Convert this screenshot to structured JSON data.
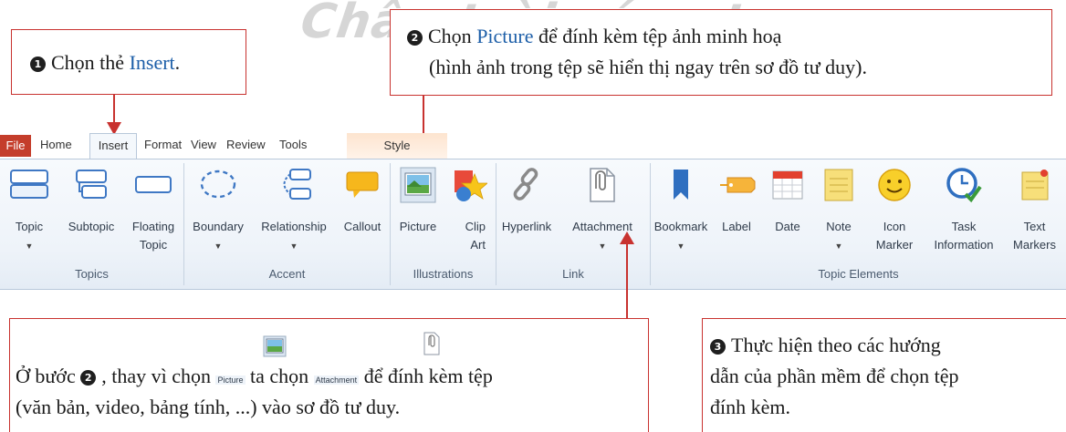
{
  "watermark": "Chân trời sáng tạo",
  "callout1": {
    "number": "1",
    "prefix": "Chọn thẻ ",
    "highlight": "Insert",
    "suffix": "."
  },
  "callout2": {
    "number": "2",
    "prefix": "Chọn ",
    "highlight": "Picture",
    "line1_suffix": " để đính kèm tệp ảnh minh hoạ",
    "line2": "(hình ảnh trong tệp sẽ hiển thị ngay trên sơ đồ tư duy)."
  },
  "callout3": {
    "number": "3",
    "line1": "Thực hiện theo các hướng",
    "line2": "dẫn của phần mềm để chọn tệp",
    "line3": "đính kèm."
  },
  "note": {
    "prefix": "Ở bước ",
    "number": "2",
    "mid1": ", thay vì chọn ",
    "picture_mini_label": "Picture",
    "mid2": " ta chọn ",
    "attachment_mini_label": "Attachment",
    "suffix": " để đính kèm tệp",
    "line2": "(văn bản, video, bảng tính, ...) vào sơ đồ tư duy."
  },
  "tabs": {
    "file": "File",
    "home": "Home",
    "insert": "Insert",
    "format": "Format",
    "view": "View",
    "review": "Review",
    "tools": "Tools",
    "style": "Style"
  },
  "ribbon": {
    "topic": "Topic",
    "subtopic": "Subtopic",
    "floating_l1": "Floating",
    "floating_l2": "Topic",
    "boundary": "Boundary",
    "relationship": "Relationship",
    "callout": "Callout",
    "picture": "Picture",
    "clip_l1": "Clip",
    "clip_l2": "Art",
    "hyperlink": "Hyperlink",
    "attachment": "Attachment",
    "bookmark": "Bookmark",
    "label": "Label",
    "date": "Date",
    "note": "Note",
    "icon_l1": "Icon",
    "icon_l2": "Marker",
    "task_l1": "Task",
    "task_l2": "Information",
    "text_l1": "Text",
    "text_l2": "Markers"
  },
  "groups": {
    "topics": "Topics",
    "accent": "Accent",
    "illustrations": "Illustrations",
    "link": "Link",
    "topic_elements": "Topic Elements"
  },
  "colors": {
    "accent_red": "#c8322f",
    "link_blue": "#1c5ea8",
    "file_tab": "#c43d2b"
  }
}
